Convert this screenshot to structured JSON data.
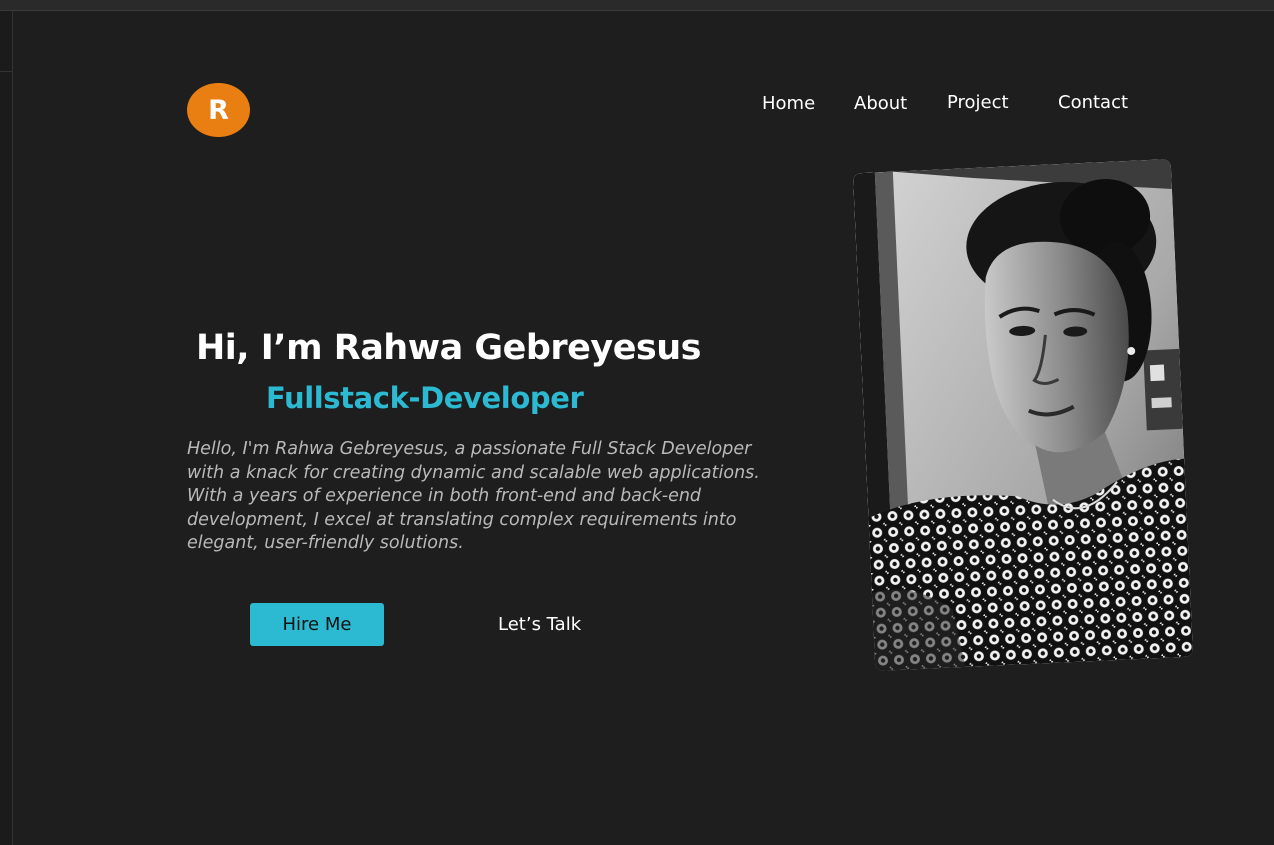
{
  "logo": {
    "letter": "R",
    "color": "#e97f12"
  },
  "nav": {
    "items": [
      {
        "label": "Home"
      },
      {
        "label": "About"
      },
      {
        "label": "Project"
      },
      {
        "label": "Contact"
      }
    ]
  },
  "hero": {
    "title": "Hi, I’m Rahwa Gebreyesus",
    "role": "Fullstack-Developer",
    "intro": "Hello, I'm Rahwa Gebreyesus, a passionate Full Stack Developer with a knack for creating dynamic and scalable web applications. With a years of experience in both front-end and back-end development, I excel at translating complex requirements into elegant, user-friendly solutions.",
    "hire_button": "Hire Me",
    "talk_button": "Let’s Talk"
  },
  "photo": {
    "style": "black-and-white portrait"
  },
  "colors": {
    "background": "#1e1e1e",
    "accent": "#2bbad1",
    "logo": "#e97f12",
    "text": "#ffffff",
    "muted_text": "#b9b9b9"
  }
}
